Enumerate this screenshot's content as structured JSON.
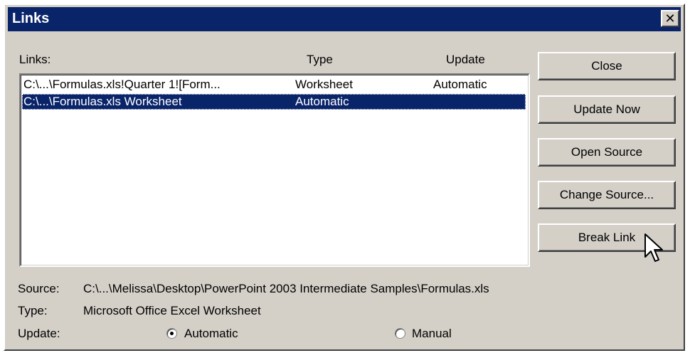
{
  "window": {
    "title": "Links",
    "close_glyph": "✕"
  },
  "list": {
    "headers": {
      "links": "Links:",
      "type": "Type",
      "update": "Update"
    },
    "rows": [
      {
        "link": "C:\\...\\Formulas.xls!Quarter 1![Form...",
        "type": "Worksheet",
        "update": "Automatic",
        "selected": false
      },
      {
        "link": "C:\\...\\Formulas.xls Worksheet",
        "type": "Automatic",
        "update": "",
        "selected": true
      }
    ]
  },
  "buttons": {
    "close": "Close",
    "update_now": "Update Now",
    "open_source": "Open Source",
    "change_source": "Change Source...",
    "break_link": "Break Link"
  },
  "details": {
    "source_label": "Source:",
    "source_value": "C:\\...\\Melissa\\Desktop\\PowerPoint 2003 Intermediate Samples\\Formulas.xls",
    "type_label": "Type:",
    "type_value": "Microsoft Office Excel Worksheet",
    "update_label": "Update:",
    "automatic_label": "Automatic",
    "manual_label": "Manual",
    "update_mode": "Automatic"
  },
  "colors": {
    "titlebar": "#0a246a",
    "face": "#d4d0c8",
    "selection": "#0a246a"
  }
}
